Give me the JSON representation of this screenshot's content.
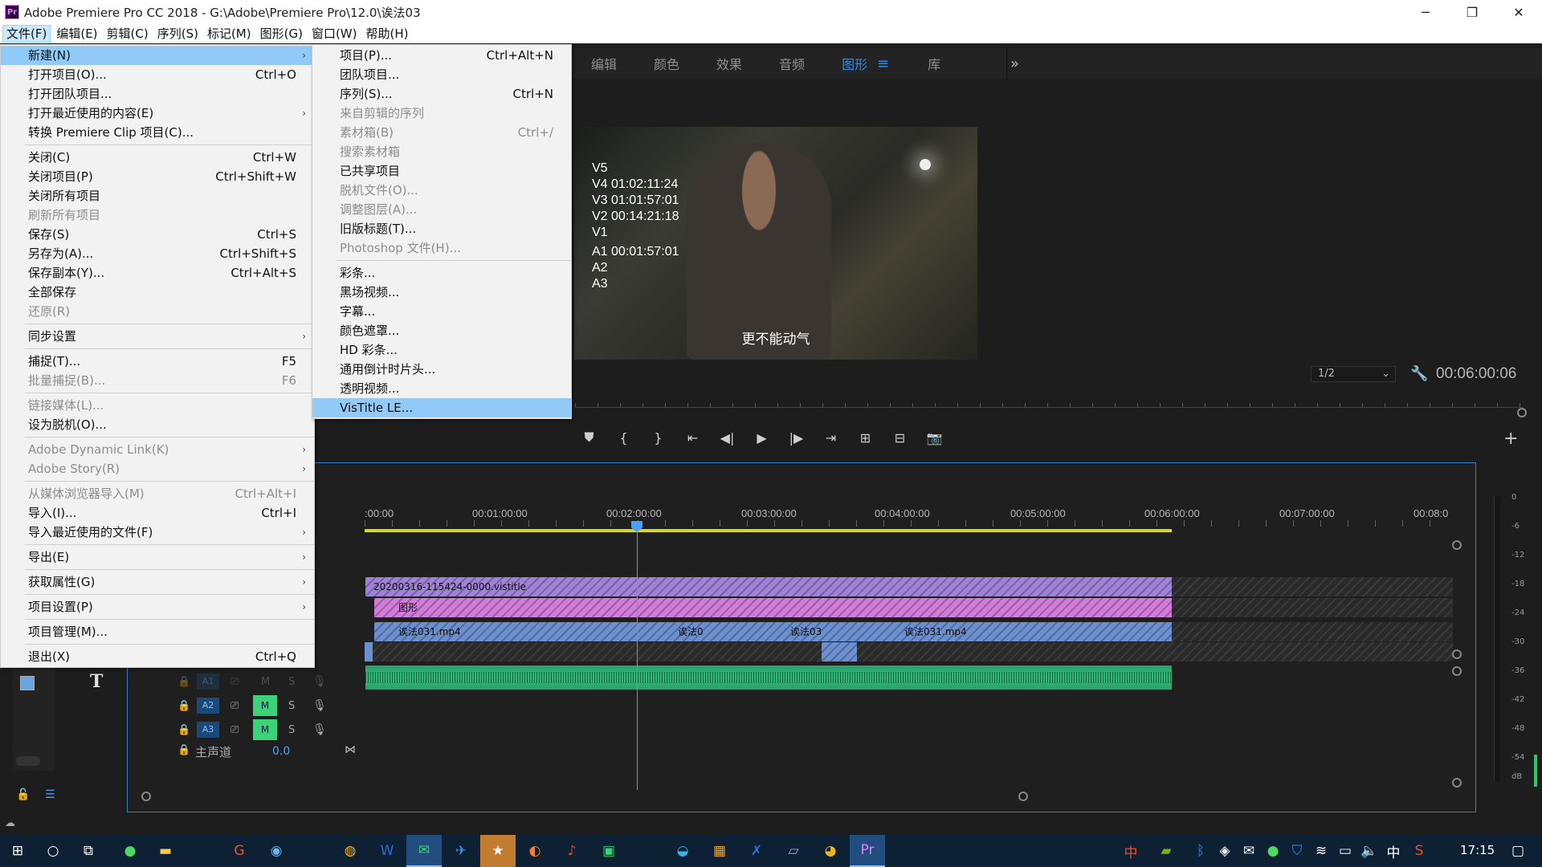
{
  "window": {
    "title": "Adobe Premiere Pro CC 2018 - G:\\Adobe\\Premiere Pro\\12.0\\诶法03",
    "app_icon": "Pr",
    "controls": [
      "─",
      "❐",
      "✕"
    ]
  },
  "menubar": [
    "文件(F)",
    "编辑(E)",
    "剪辑(C)",
    "序列(S)",
    "标记(M)",
    "图形(G)",
    "窗口(W)",
    "帮助(H)"
  ],
  "file_menu": [
    {
      "label": "新建(N)",
      "shortcut": "",
      "arrow": true,
      "disabled": false,
      "highlighted": true
    },
    {
      "label": "打开项目(O)...",
      "shortcut": "Ctrl+O"
    },
    {
      "label": "打开团队项目..."
    },
    {
      "label": "打开最近使用的内容(E)",
      "arrow": true
    },
    {
      "label": "转换 Premiere Clip 项目(C)..."
    },
    {
      "sep": true
    },
    {
      "label": "关闭(C)",
      "shortcut": "Ctrl+W"
    },
    {
      "label": "关闭项目(P)",
      "shortcut": "Ctrl+Shift+W"
    },
    {
      "label": "关闭所有项目"
    },
    {
      "label": "刷新所有项目",
      "disabled": true
    },
    {
      "label": "保存(S)",
      "shortcut": "Ctrl+S"
    },
    {
      "label": "另存为(A)...",
      "shortcut": "Ctrl+Shift+S"
    },
    {
      "label": "保存副本(Y)...",
      "shortcut": "Ctrl+Alt+S"
    },
    {
      "label": "全部保存"
    },
    {
      "label": "还原(R)",
      "disabled": true
    },
    {
      "sep": true
    },
    {
      "label": "同步设置",
      "arrow": true
    },
    {
      "sep": true
    },
    {
      "label": "捕捉(T)...",
      "shortcut": "F5"
    },
    {
      "label": "批量捕捉(B)...",
      "shortcut": "F6",
      "disabled": true
    },
    {
      "sep": true
    },
    {
      "label": "链接媒体(L)...",
      "disabled": true
    },
    {
      "label": "设为脱机(O)..."
    },
    {
      "sep": true
    },
    {
      "label": "Adobe Dynamic Link(K)",
      "arrow": true,
      "disabled": true
    },
    {
      "label": "Adobe Story(R)",
      "arrow": true,
      "disabled": true
    },
    {
      "sep": true
    },
    {
      "label": "从媒体浏览器导入(M)",
      "shortcut": "Ctrl+Alt+I",
      "disabled": true
    },
    {
      "label": "导入(I)...",
      "shortcut": "Ctrl+I"
    },
    {
      "label": "导入最近使用的文件(F)",
      "arrow": true
    },
    {
      "sep": true
    },
    {
      "label": "导出(E)",
      "arrow": true
    },
    {
      "sep": true
    },
    {
      "label": "获取属性(G)",
      "arrow": true
    },
    {
      "sep": true
    },
    {
      "label": "项目设置(P)",
      "arrow": true
    },
    {
      "sep": true
    },
    {
      "label": "项目管理(M)..."
    },
    {
      "sep": true
    },
    {
      "label": "退出(X)",
      "shortcut": "Ctrl+Q"
    }
  ],
  "new_submenu": [
    {
      "label": "项目(P)...",
      "shortcut": "Ctrl+Alt+N"
    },
    {
      "label": "团队项目..."
    },
    {
      "label": "序列(S)...",
      "shortcut": "Ctrl+N"
    },
    {
      "label": "来自剪辑的序列",
      "disabled": true
    },
    {
      "label": "素材箱(B)",
      "shortcut": "Ctrl+/",
      "disabled": true
    },
    {
      "label": "搜索素材箱",
      "disabled": true
    },
    {
      "label": "已共享项目"
    },
    {
      "label": "脱机文件(O)...",
      "disabled": true
    },
    {
      "label": "调整图层(A)...",
      "disabled": true
    },
    {
      "label": "旧版标题(T)..."
    },
    {
      "label": "Photoshop 文件(H)...",
      "disabled": true
    },
    {
      "sep": true
    },
    {
      "label": "彩条..."
    },
    {
      "label": "黑场视频..."
    },
    {
      "label": "字幕..."
    },
    {
      "label": "颜色遮罩..."
    },
    {
      "label": "HD 彩条..."
    },
    {
      "label": "通用倒计时片头..."
    },
    {
      "label": "透明视频..."
    },
    {
      "label": "VisTitle LE...",
      "highlighted": true
    }
  ],
  "workspace_tabs": [
    "编辑",
    "颜色",
    "效果",
    "音频",
    "图形",
    "库"
  ],
  "workspace_selected": "图形",
  "workspace_more": "»",
  "program_monitor": {
    "overlay_lines": [
      "V5",
      "V4 01:02:11:24",
      "V3 01:01:57:01",
      "V2 00:14:21:18",
      "V1",
      "A1 00:01:57:01",
      "A2",
      "A3"
    ],
    "subtitle": "更不能动气",
    "zoom": "1/2",
    "timecode": "00:06:00:06"
  },
  "transport_icons": [
    "marker-icon",
    "in-point-icon",
    "out-point-icon",
    "go-to-in-icon",
    "step-back-icon",
    "play-icon",
    "step-forward-icon",
    "go-to-out-icon",
    "lift-icon",
    "extract-icon",
    "export-frame-icon"
  ],
  "transport_glyphs": [
    "⛊",
    "{",
    "}",
    "⇤",
    "◀|",
    "▶",
    "|▶",
    "⇥",
    "⊞",
    "⊟",
    "📷"
  ],
  "timeline": {
    "ruler": [
      ":00:00",
      "00:01:00:00",
      "00:02:00:00",
      "00:03:00:00",
      "00:04:00:00",
      "00:05:00:00",
      "00:06:00:00",
      "00:07:00:00",
      "00:08:0"
    ],
    "clips": {
      "v5": "20200316-115424-0000.vistitle",
      "v4": "图形",
      "v3": "诶法031.mp4",
      "v3b": "诶法0",
      "v3c": "诶法03",
      "v3d": "诶法031.mp4"
    },
    "tracks": [
      {
        "name": "A1",
        "dim": true
      },
      {
        "name": "A2",
        "dim": false
      },
      {
        "name": "A3",
        "dim": false
      }
    ],
    "m_label": "M",
    "s_label": "S",
    "master": {
      "name": "主声道",
      "value": "0.0"
    }
  },
  "meter_labels": [
    "0",
    "-6",
    "-12",
    "-18",
    "-24",
    "-30",
    "-36",
    "-42",
    "-48",
    "-54",
    "dB"
  ],
  "taskbar": {
    "time": "17:15",
    "ime": "中"
  },
  "colors": {
    "accent": "#2d8ceb",
    "v5": "#a082d8",
    "v4": "#d17cd8",
    "v3": "#6c8fd0",
    "audio": "#2fc07a",
    "playhead": "#4aa0ff",
    "workarea": "#d9d919"
  }
}
